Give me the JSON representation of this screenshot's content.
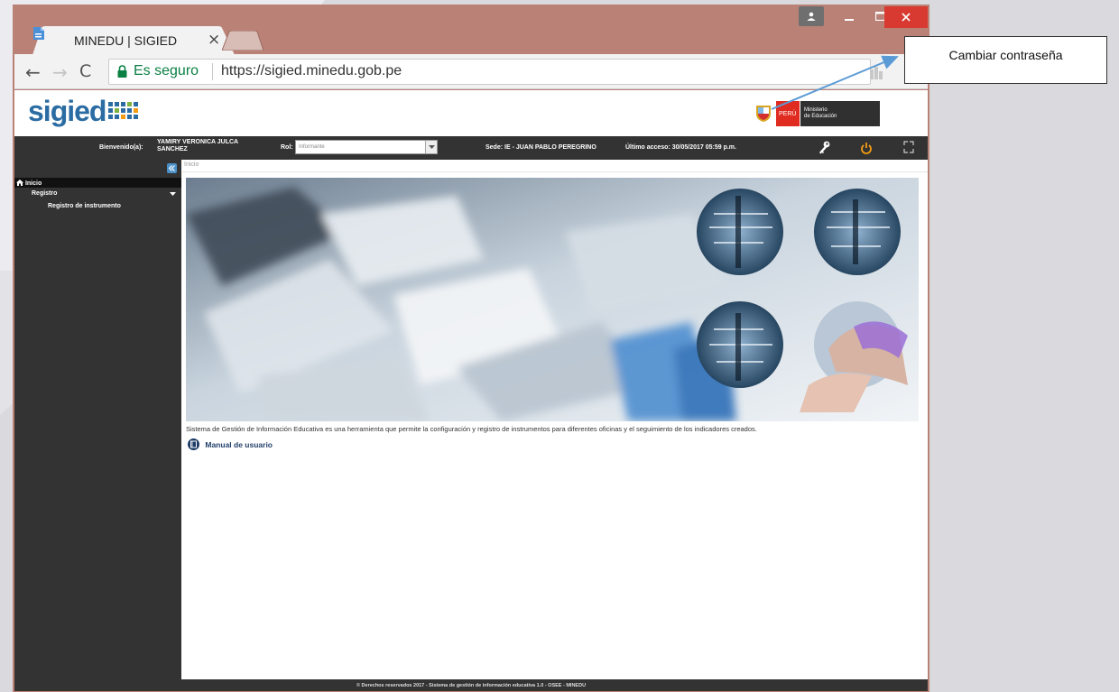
{
  "browser": {
    "tab_title": "MINEDU | SIGIED",
    "tab_close": "×",
    "secure_label": "Es seguro",
    "url": "https://sigied.minedu.gob.pe",
    "back": "←",
    "forward": "→",
    "reload": "C",
    "zoom": "⊖",
    "star": "☆"
  },
  "site": {
    "logo_text": "sigied",
    "gov_peru": "PERÚ",
    "gov_ministry_line1": "Ministerio",
    "gov_ministry_line2": "de Educación"
  },
  "userbar": {
    "welcome_label": "Bienvenido(a):",
    "user_name": "YAMIRY VERONICA JULCA SANCHEZ",
    "rol_label": "Rol:",
    "rol_value": "Informante",
    "sede": "Sede: IE - JUAN PABLO PEREGRINO",
    "ultimo_acceso": "Último acceso: 30/05/2017 05:59 p.m."
  },
  "sidebar": {
    "items": [
      {
        "label": "Inicio"
      },
      {
        "label": "Registro"
      },
      {
        "label": "Registro de instrumento"
      }
    ]
  },
  "main": {
    "breadcrumb": "Inicio",
    "description": "Sistema de Gestión de Información Educativa es una herramienta que permite la configuración y registro de instrumentos para diferentes oficinas y el seguimiento de los indicadores creados.",
    "manual_link": "Manual de usuario"
  },
  "footer": {
    "text": "© Derechos reservados 2017 - Sistema de gestión de información educativa 1.0 - OSEE - MINEDU"
  },
  "annotation": {
    "callout_text": "Cambiar contraseña"
  },
  "colors": {
    "chrome_frame": "#ba8176",
    "close_button": "#d83a31",
    "dark_bar": "#333333",
    "logo_blue": "#2b6ca3",
    "secure_green": "#0b8043",
    "power_orange": "#f39c12",
    "callout_arrow": "#5b9bd5"
  }
}
